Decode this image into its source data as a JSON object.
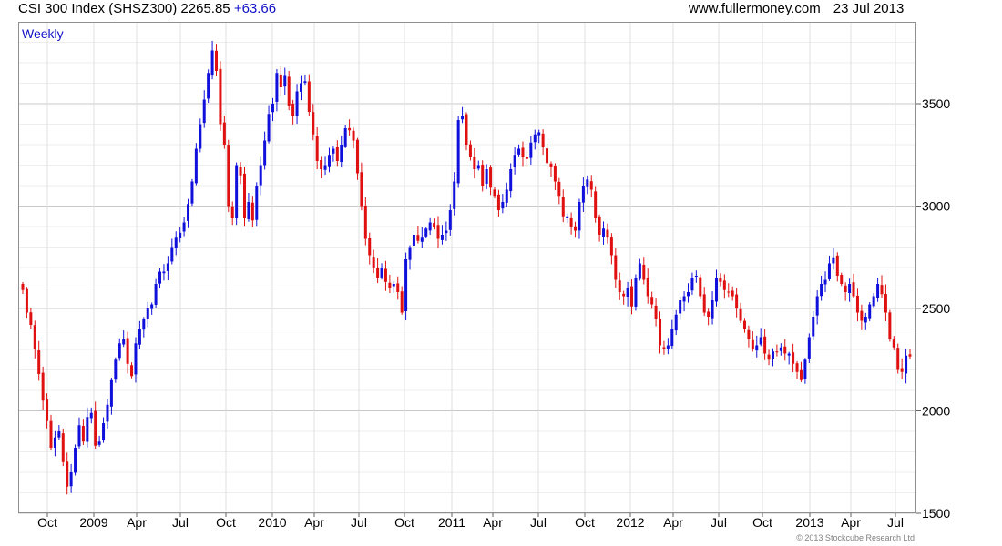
{
  "header": {
    "title": "CSI 300 Index (SHSZ300) 2265.85",
    "change": "+63.66",
    "site": "www.fullermoney.com",
    "date": "23 Jul 2013"
  },
  "footer": {
    "copyright": "© 2013 Stockcube Research Ltd"
  },
  "colors": {
    "up": "#1010dd",
    "down": "#e01010",
    "grid": "#dcdcdc",
    "frame": "#909090",
    "accent": "#1010c8"
  },
  "chart_data": {
    "type": "candlestick",
    "period": "Weekly",
    "ylim": [
      1500,
      3900
    ],
    "y_ticks": [
      1500,
      2000,
      2500,
      3000,
      3500
    ],
    "x_tick_labels": [
      "Oct",
      "2009",
      "Apr",
      "Jul",
      "Oct",
      "2010",
      "Apr",
      "Jul",
      "Oct",
      "2011",
      "Apr",
      "Jul",
      "Oct",
      "2012",
      "Apr",
      "Jul",
      "Oct",
      "2013",
      "Apr",
      "Jul"
    ],
    "grid": true,
    "close_series": [
      2590,
      2480,
      2420,
      2300,
      2180,
      2050,
      1950,
      1820,
      1870,
      1900,
      1750,
      1630,
      1700,
      1820,
      1930,
      1850,
      1970,
      1990,
      1830,
      1850,
      1940,
      2030,
      2150,
      2250,
      2330,
      2350,
      2230,
      2170,
      2330,
      2400,
      2450,
      2500,
      2520,
      2620,
      2680,
      2680,
      2720,
      2800,
      2850,
      2870,
      2920,
      3010,
      3120,
      3280,
      3400,
      3520,
      3650,
      3760,
      3660,
      3400,
      3300,
      3000,
      2940,
      3200,
      3150,
      2940,
      3020,
      2930,
      3100,
      3200,
      3320,
      3450,
      3500,
      3650,
      3580,
      3640,
      3490,
      3440,
      3560,
      3600,
      3610,
      3460,
      3350,
      3220,
      3180,
      3200,
      3250,
      3280,
      3220,
      3300,
      3380,
      3370,
      3320,
      3160,
      3000,
      2840,
      2760,
      2700,
      2650,
      2700,
      2630,
      2600,
      2620,
      2580,
      2480,
      2740,
      2800,
      2860,
      2830,
      2850,
      2890,
      2920,
      2900,
      2840,
      2860,
      2880,
      2980,
      3120,
      3420,
      3440,
      3300,
      3240,
      3180,
      3200,
      3100,
      3180,
      3090,
      3050,
      2980,
      3020,
      3080,
      3180,
      3250,
      3280,
      3240,
      3230,
      3310,
      3350,
      3360,
      3290,
      3210,
      3190,
      3120,
      3050,
      2950,
      2950,
      2900,
      2880,
      3020,
      3100,
      3130,
      3080,
      2940,
      2860,
      2890,
      2850,
      2760,
      2640,
      2580,
      2560,
      2600,
      2510,
      2650,
      2720,
      2640,
      2560,
      2520,
      2450,
      2320,
      2300,
      2320,
      2400,
      2470,
      2540,
      2560,
      2580,
      2650,
      2660,
      2560,
      2480,
      2460,
      2540,
      2650,
      2630,
      2590,
      2580,
      2560,
      2500,
      2440,
      2400,
      2350,
      2300,
      2320,
      2360,
      2280,
      2250,
      2290,
      2290,
      2310,
      2280,
      2280,
      2230,
      2190,
      2150,
      2250,
      2360,
      2460,
      2560,
      2620,
      2640,
      2720,
      2750,
      2660,
      2620,
      2580,
      2620,
      2560,
      2480,
      2440,
      2460,
      2520,
      2560,
      2620,
      2570,
      2480,
      2350,
      2310,
      2200,
      2190,
      2270,
      2265.85
    ]
  }
}
